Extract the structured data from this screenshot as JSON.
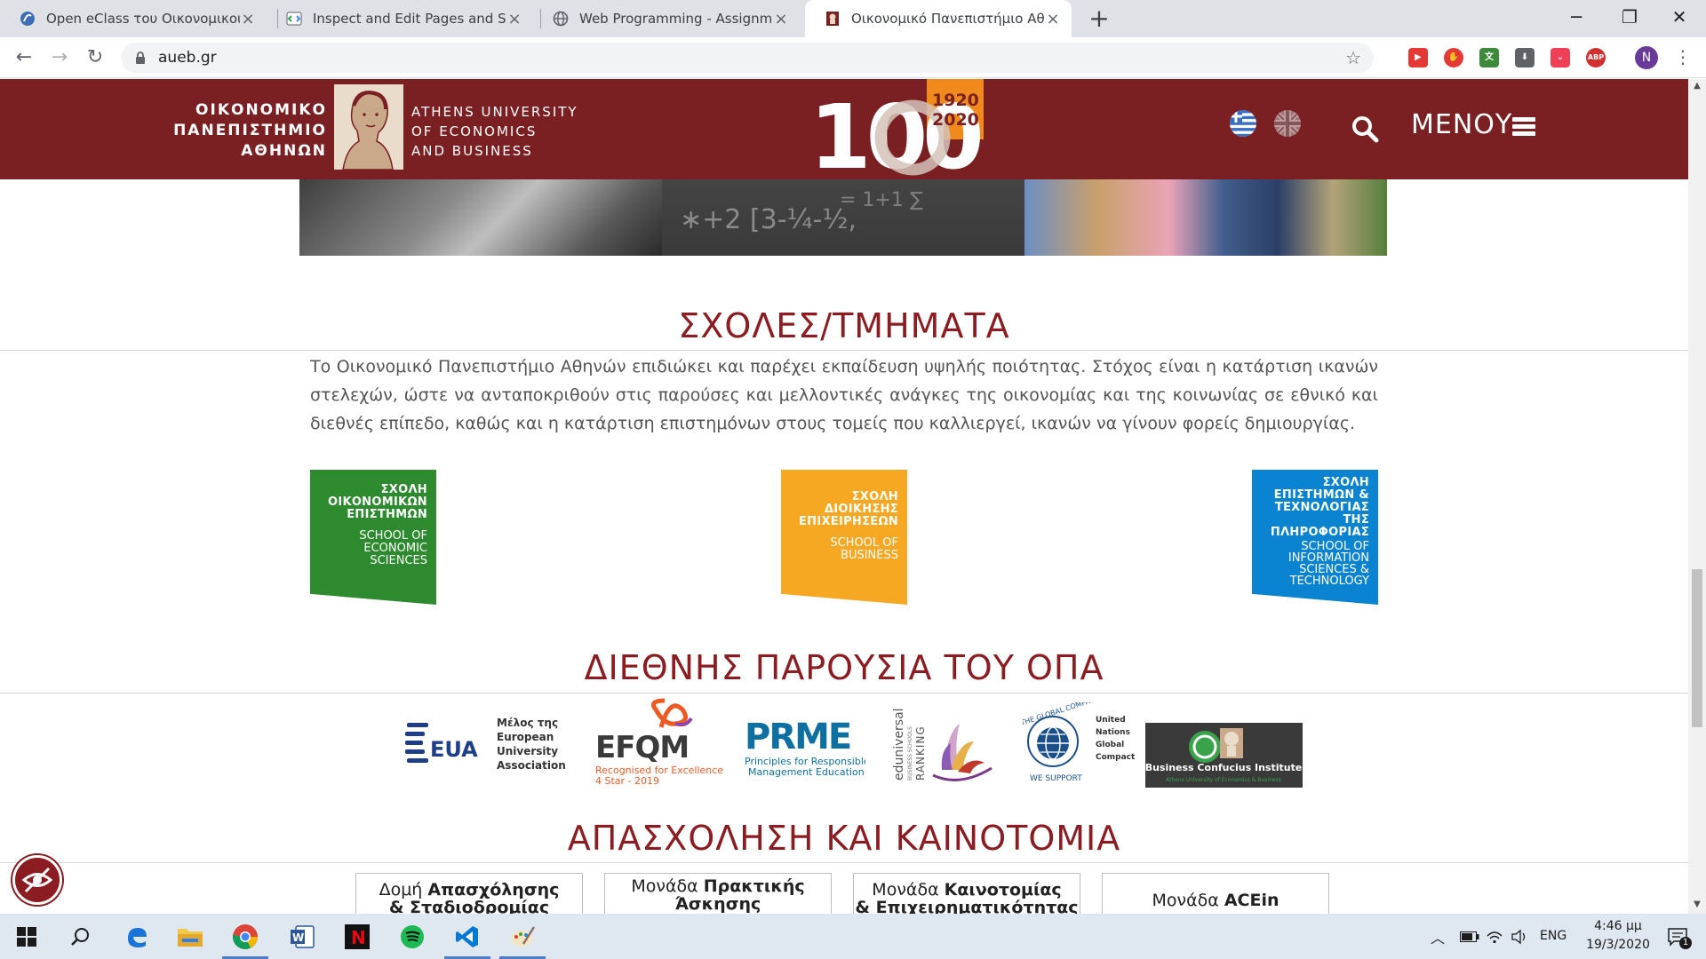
{
  "browser": {
    "tabs": [
      {
        "title": "Open eClass του Οικονομικού Πανεπιστημίου",
        "active": false
      },
      {
        "title": "Inspect and Edit Pages and Styles",
        "active": false
      },
      {
        "title": "Web Programming - Assignment",
        "active": false
      },
      {
        "title": "Οικονομικό Πανεπιστήμιο Αθηνών",
        "active": true
      }
    ],
    "new_tab_label": "+",
    "url": "aueb.gr",
    "profile_initial": "N",
    "extensions": [
      {
        "icon": "youtube-icon",
        "color": "#e53935"
      },
      {
        "icon": "adblock-hand-icon",
        "color": "#e53935"
      },
      {
        "icon": "translate-icon",
        "color": "#3c8a3a"
      },
      {
        "icon": "download-icon",
        "color": "#5f6368"
      },
      {
        "icon": "pocket-icon",
        "color": "#ef4056"
      },
      {
        "icon": "abp-icon",
        "color": "#d32f2f",
        "label": "ABP"
      }
    ]
  },
  "site": {
    "logo_gr": [
      "ΟΙΚΟΝΟΜΙΚΟ",
      "ΠΑΝΕΠΙΣΤΗΜΙΟ",
      "ΑΘΗΝΩΝ"
    ],
    "logo_en": [
      "ATHENS UNIVERSITY",
      "OF ECONOMICS",
      "AND BUSINESS"
    ],
    "anniversary": {
      "number": "100",
      "years_top": "1920",
      "years_bottom": "2020"
    },
    "menu_label": "ΜΕΝΟΥ",
    "brand_color": "#7a1f22",
    "accent_color": "#8b1d22",
    "sections": {
      "schools_title": "ΣΧΟΛΕΣ/ΤΜΗΜΑΤΑ",
      "schools_intro": "Το Οικονομικό Πανεπιστήμιο Αθηνών επιδιώκει και παρέχει εκπαίδευση υψηλής ποιότητας. Στόχος είναι η κατάρτιση ικανών στελεχών, ώστε να ανταποκριθούν στις παρούσες και μελλοντικές ανάγκες της οικονομίας και της κοινωνίας σε εθνικό και διεθνές επίπεδο, καθώς και η κατάρτιση επιστημόνων στους τομείς που καλλιεργεί, ικανών να γίνουν φορείς δημιουργίας.",
      "international_title": "ΔΙΕΘΝΗΣ ΠΑΡΟΥΣΙΑ ΤΟΥ ΟΠΑ",
      "jobs_title": "ΑΠΑΣΧΟΛΗΣΗ ΚΑΙ ΚΑΙΝΟΤΟΜΙΑ"
    },
    "schools": [
      {
        "gr": [
          "ΣΧΟΛΗ",
          "ΟΙΚΟΝΟΜΙΚΩΝ",
          "ΕΠΙΣΤΗΜΩΝ"
        ],
        "en": [
          "SCHOOL OF",
          "ECONOMIC",
          "SCIENCES"
        ],
        "color": "#2e8a2f"
      },
      {
        "gr": [
          "ΣΧΟΛΗ",
          "ΔΙΟΙΚΗΣΗΣ",
          "ΕΠΙΧΕΙΡΗΣΕΩΝ"
        ],
        "en": [
          "SCHOOL OF",
          "BUSINESS"
        ],
        "color": "#f7a823"
      },
      {
        "gr": [
          "ΣΧΟΛΗ",
          "ΕΠΙΣΤΗΜΩΝ &",
          "ΤΕΧΝΟΛΟΓΙΑΣ",
          "ΤΗΣ",
          "ΠΛΗΡΟΦΟΡΙΑΣ"
        ],
        "en": [
          "SCHOOL OF",
          "INFORMATION",
          "SCIENCES &",
          "TECHNOLOGY"
        ],
        "color": "#0a84d0"
      }
    ],
    "partners": {
      "eua": {
        "abbr": "EUA",
        "text": [
          "Μέλος της",
          "European",
          "University",
          "Association"
        ]
      },
      "efqm": {
        "abbr": "EFQM",
        "sub": [
          "Recognised for Excellence",
          "4 Star - 2019"
        ]
      },
      "prme": {
        "abbr": "PRME",
        "sub": [
          "Principles for Responsible",
          "Management Education"
        ]
      },
      "eduniversal": {
        "vertical": [
          "eduniversal",
          "BUSINESS SCHOOLS",
          "RANKING"
        ]
      },
      "ungc": {
        "ring": "THE GLOBAL COMPACT",
        "support": "WE SUPPORT",
        "text": [
          "United",
          "Nations",
          "Global",
          "Compact"
        ]
      },
      "confucius": {
        "title": "Business Confucius Institute",
        "sub": "Athens University of Economics & Business"
      }
    },
    "jobs_buttons": [
      {
        "pre": "Δομή ",
        "bold": "Απασχόλησης",
        "line2": "& Σταδιοδρομίας"
      },
      {
        "pre": "Μονάδα ",
        "bold": "Πρακτικής",
        "line2": "Άσκησης"
      },
      {
        "pre": "Μονάδα ",
        "bold": "Καινοτομίας",
        "line2": "& Επιχειρηματικότητας"
      },
      {
        "pre": "Μονάδα ",
        "bold": "ACEin",
        "line2": ""
      }
    ]
  },
  "taskbar": {
    "lang": "ENG",
    "time": "4:46 μμ",
    "date": "19/3/2020",
    "notifications": "1"
  }
}
